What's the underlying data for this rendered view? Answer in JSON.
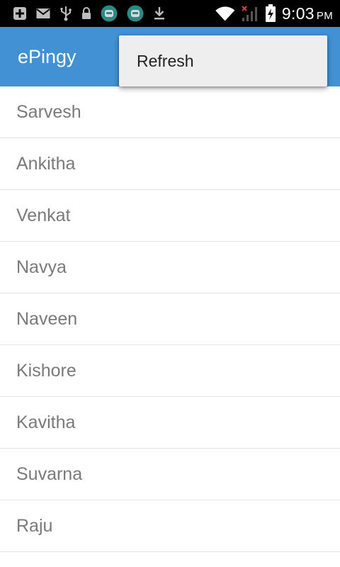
{
  "status_bar": {
    "time": "9:03",
    "ampm": "PM",
    "left_icons": [
      "add-box-icon",
      "mail-icon",
      "usb-icon",
      "lock-icon",
      "android-app-icon",
      "android-app-icon",
      "download-icon"
    ],
    "right_icons": [
      "wifi-icon",
      "no-signal-icon",
      "battery-charging-icon"
    ]
  },
  "app_bar": {
    "title": "ePingy",
    "color": "#4191d4"
  },
  "menu": {
    "items": [
      {
        "label": "Refresh"
      }
    ]
  },
  "contacts": [
    {
      "name": "Sarvesh"
    },
    {
      "name": "Ankitha"
    },
    {
      "name": "Venkat"
    },
    {
      "name": "Navya"
    },
    {
      "name": "Naveen"
    },
    {
      "name": "Kishore"
    },
    {
      "name": "Kavitha"
    },
    {
      "name": "Suvarna"
    },
    {
      "name": "Raju"
    }
  ]
}
